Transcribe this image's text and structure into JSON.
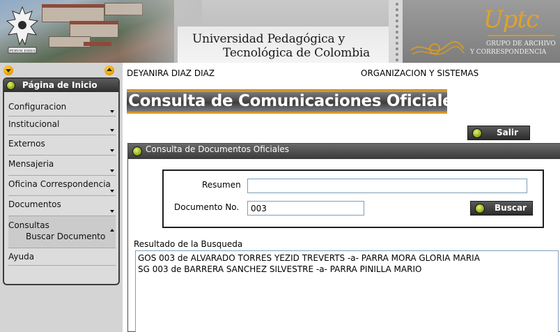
{
  "header": {
    "university_line1": "Universidad Pedagógica y",
    "university_line2": "Tecnológica de Colombia",
    "crest_motto": "PERVM EIRES",
    "logo_text": "Uptc",
    "dept_line1": "GRUPO DE ARCHIVO",
    "dept_line2": "Y CORRESPONDENCIA"
  },
  "sidebar": {
    "scroll_down_icon": "arrow-down-circle-icon",
    "scroll_up_icon": "arrow-up-circle-icon",
    "home_label": "Página de Inicio",
    "items": [
      {
        "label": "Configuracion",
        "expandable": true,
        "expanded": false
      },
      {
        "label": "Institucional",
        "expandable": true,
        "expanded": false
      },
      {
        "label": "Externos",
        "expandable": true,
        "expanded": false
      },
      {
        "label": "Mensajeria",
        "expandable": true,
        "expanded": false
      },
      {
        "label": "Oficina Correspondencia",
        "expandable": true,
        "expanded": false
      },
      {
        "label": "Documentos",
        "expandable": true,
        "expanded": false
      },
      {
        "label": "Consultas",
        "expandable": true,
        "expanded": true,
        "subitems": [
          {
            "label": "Buscar Documento"
          }
        ]
      },
      {
        "label": "Ayuda",
        "expandable": false,
        "expanded": false
      }
    ]
  },
  "main": {
    "user_name": "DEYANIRA DIAZ DIAZ",
    "department": "ORGANIZACION Y SISTEMAS",
    "page_title": "Consulta de Comunicaciones Oficiales",
    "exit_button": "Salir",
    "panel_title": "Consulta de Documentos Oficiales",
    "form": {
      "resumen_label": "Resumen",
      "resumen_value": "",
      "documento_label": "Documento No.",
      "documento_value": "003",
      "search_button": "Buscar"
    },
    "results_label": "Resultado de la Busqueda",
    "results": [
      "GOS 003 de ALVARADO TORRES YEZID TREVERTS -a- PARRA MORA GLORIA MARIA",
      "SG 003 de BARRERA SANCHEZ SILVESTRE -a- PARRA PINILLA MARIO"
    ]
  },
  "colors": {
    "accent_gold": "#d39a2a",
    "dark_bar": "#3a3a3a",
    "button_icon_green": "#8ca11a",
    "sidebar_bg": "#d4d4d4"
  }
}
